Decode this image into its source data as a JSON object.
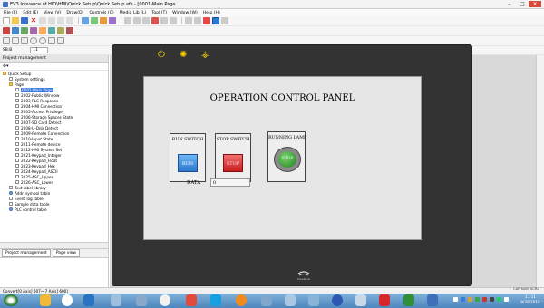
{
  "window": {
    "title": "EV3 Inovance of HIO\\HMI\\Quick Setup\\Quick Setup.afs - [0001-Main Page",
    "controls": [
      "–",
      "□",
      "✕"
    ]
  },
  "menubar": [
    "File (F)",
    "Edit (E)",
    "View (V)",
    "Draw(D)",
    "Controls (C)",
    "Media Lib (L)",
    "Tool (T)",
    "Window (W)",
    "Help (H)"
  ],
  "toolbar_zoom_value": "11",
  "toolbar_label_left": "SB:B",
  "sidebar": {
    "header": "Project management",
    "tree": [
      {
        "label": "Quick Setup",
        "level": 0,
        "kind": "folder"
      },
      {
        "label": "System settings",
        "level": 1,
        "kind": "item"
      },
      {
        "label": "Page",
        "level": 1,
        "kind": "folder"
      },
      {
        "label": "0001-Main Page",
        "level": 2,
        "kind": "item",
        "selected": true
      },
      {
        "label": "2002-Public Window",
        "level": 2,
        "kind": "item"
      },
      {
        "label": "2003-PLC Response",
        "level": 2,
        "kind": "item"
      },
      {
        "label": "2004-HMI Connection",
        "level": 2,
        "kind": "item"
      },
      {
        "label": "2005-Access Privilege",
        "level": 2,
        "kind": "item"
      },
      {
        "label": "2006-Storage Spaces State",
        "level": 2,
        "kind": "item"
      },
      {
        "label": "2007-SD Card Detect",
        "level": 2,
        "kind": "item"
      },
      {
        "label": "2008-U-Disk Detect",
        "level": 2,
        "kind": "item"
      },
      {
        "label": "2009-Remote Connection",
        "level": 2,
        "kind": "item"
      },
      {
        "label": "2010-Input State",
        "level": 2,
        "kind": "item"
      },
      {
        "label": "2011-Remote device",
        "level": 2,
        "kind": "item"
      },
      {
        "label": "2012-HMI System Set",
        "level": 2,
        "kind": "item"
      },
      {
        "label": "2021-Keypad_Integer",
        "level": 2,
        "kind": "item"
      },
      {
        "label": "2022-Keypad_Float",
        "level": 2,
        "kind": "item"
      },
      {
        "label": "2023-Keypad_Hex",
        "level": 2,
        "kind": "item"
      },
      {
        "label": "2024-Keypad_ASCII",
        "level": 2,
        "kind": "item"
      },
      {
        "label": "2025-ASC_Upper",
        "level": 2,
        "kind": "item"
      },
      {
        "label": "2026-ASC_Lower",
        "level": 2,
        "kind": "item"
      },
      {
        "label": "Text label library",
        "level": 1,
        "kind": "item"
      },
      {
        "label": "Addr. symbol table",
        "level": 1,
        "kind": "db"
      },
      {
        "label": "Event log table",
        "level": 1,
        "kind": "item"
      },
      {
        "label": "Sample data table",
        "level": 1,
        "kind": "item"
      },
      {
        "label": "PLC control table",
        "level": 1,
        "kind": "db"
      }
    ],
    "tabs": [
      "Project management",
      "Page view"
    ]
  },
  "statusbar": "Convert[0 Axis]  507~ 7 Axis]  600]",
  "statusbar_right": "CAP NUM SCRL",
  "panel": {
    "title": "OPERATION CONTROL PANEL",
    "run_switch_label": "RUN SWITCH",
    "run_button": "RUN",
    "stop_switch_label": "STOP SWITCH",
    "stop_button": "STOP",
    "lamp_label": "RUNNING LAMP",
    "lamp_state": "STOP",
    "data_label": "DATA",
    "data_value": "0",
    "logo_text": "Inovance"
  },
  "taskbar": {
    "time": "17:11",
    "date": "9/30/2016"
  },
  "colors": {
    "run": "#3d8fe0",
    "stop": "#e02a2a",
    "lamp": "#2f9a2f",
    "hmi_frame": "#333333",
    "accent": "#3b7be0"
  }
}
